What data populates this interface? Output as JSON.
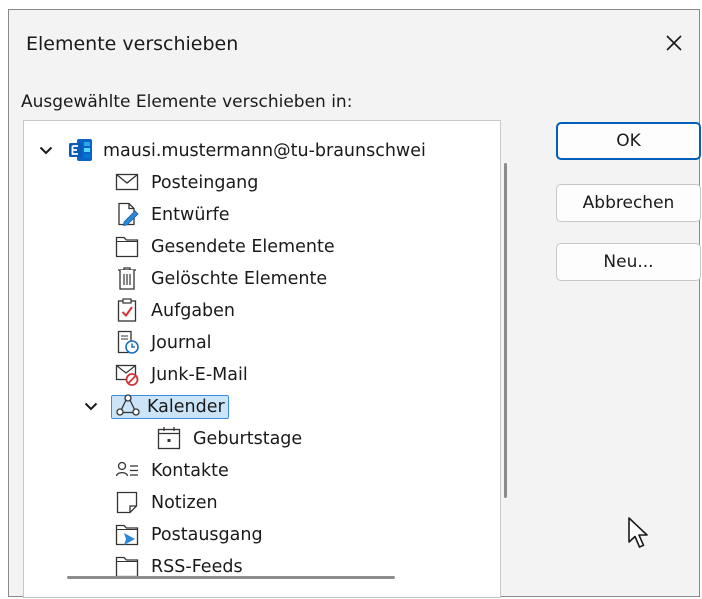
{
  "dialog": {
    "title": "Elemente verschieben",
    "prompt": "Ausgewählte Elemente verschieben in:"
  },
  "tree": {
    "account": "mausi.mustermann@tu-braunschwei",
    "items": [
      {
        "label": "Posteingang",
        "icon": "inbox-icon"
      },
      {
        "label": "Entwürfe",
        "icon": "drafts-icon"
      },
      {
        "label": "Gesendete Elemente",
        "icon": "sent-folder-icon"
      },
      {
        "label": "Gelöschte Elemente",
        "icon": "trash-icon"
      },
      {
        "label": "Aufgaben",
        "icon": "tasks-icon"
      },
      {
        "label": "Journal",
        "icon": "journal-icon"
      },
      {
        "label": "Junk-E-Mail",
        "icon": "junk-mail-icon"
      },
      {
        "label": "Kalender",
        "icon": "calendar-icon",
        "selected": true
      },
      {
        "label": "Geburtstage",
        "icon": "birthday-calendar-icon"
      },
      {
        "label": "Kontakte",
        "icon": "contacts-icon"
      },
      {
        "label": "Notizen",
        "icon": "notes-icon"
      },
      {
        "label": "Postausgang",
        "icon": "outbox-icon"
      },
      {
        "label": "RSS-Feeds",
        "icon": "rss-folder-icon"
      }
    ]
  },
  "buttons": {
    "ok": "OK",
    "cancel": "Abbrechen",
    "new": "Neu..."
  },
  "colors": {
    "accent": "#005fb8",
    "selection_fill": "#cce4f7",
    "selection_border": "#3b8de0",
    "exchange_brand": "#0a64c8"
  }
}
